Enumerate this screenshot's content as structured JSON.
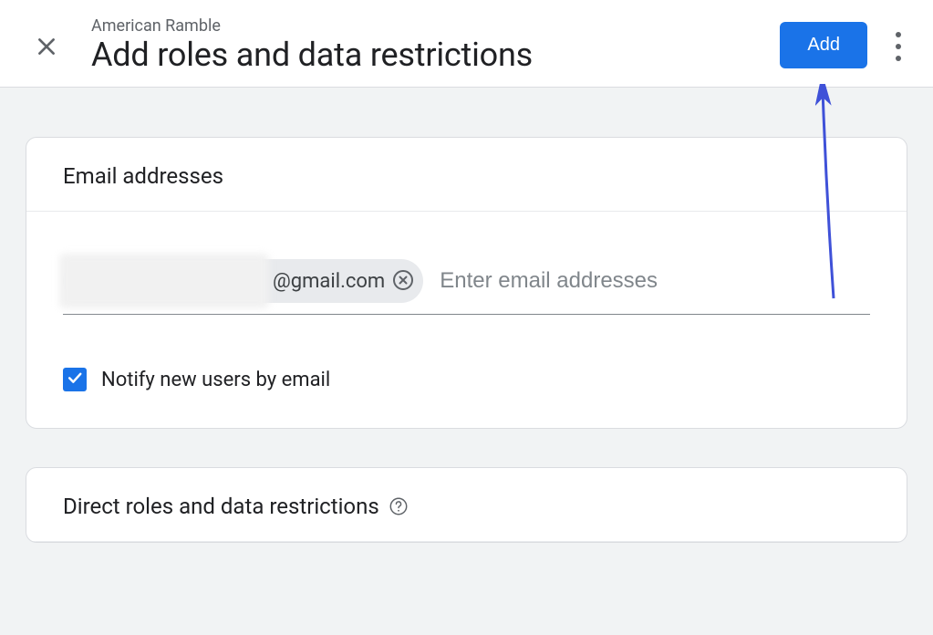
{
  "header": {
    "breadcrumb": "American Ramble",
    "title": "Add roles and data restrictions",
    "add_button_label": "Add"
  },
  "emails": {
    "section_title": "Email addresses",
    "chip_domain": "@gmail.com",
    "input_placeholder": "Enter email addresses",
    "notify_label": "Notify new users by email",
    "notify_checked": true
  },
  "roles": {
    "section_title": "Direct roles and data restrictions"
  }
}
